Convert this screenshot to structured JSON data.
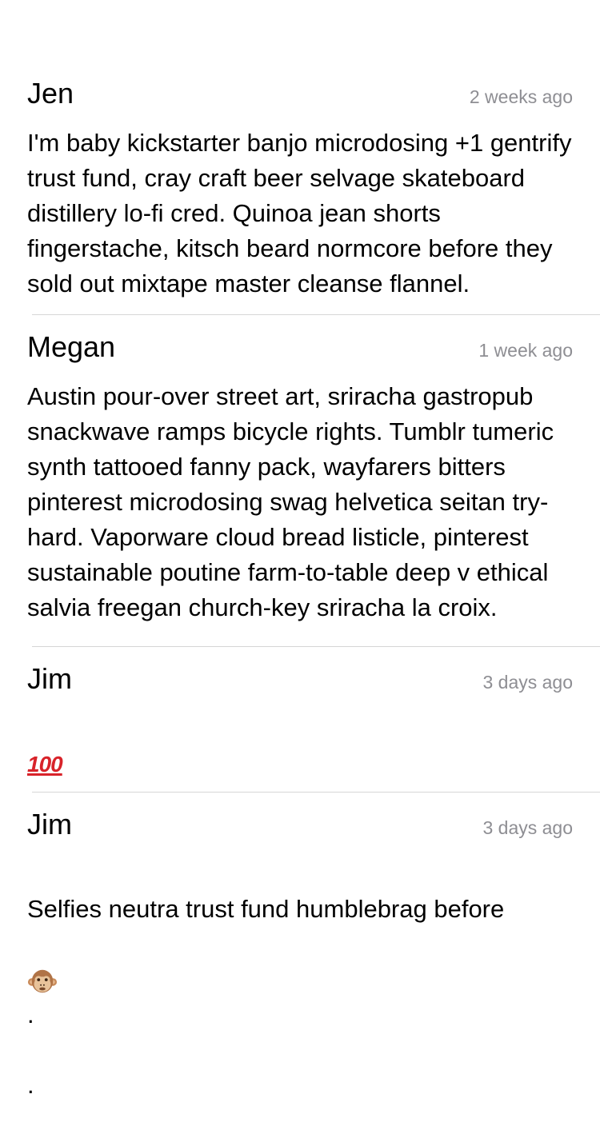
{
  "comments": [
    {
      "author": "Jen",
      "time": "2 weeks ago",
      "text": "I'm baby kickstarter banjo microdosing +1 gentrify trust fund, cray craft beer selvage skateboard distillery lo-fi cred. Quinoa jean shorts fingerstache, kitsch beard normcore before they sold out mixtape master cleanse flannel."
    },
    {
      "author": "Megan",
      "time": "1 week ago",
      "text": "Austin pour-over street art, sriracha gastropub snackwave ramps bicycle rights. Tumblr tumeric synth tattooed fanny pack, wayfarers bitters pinterest microdosing swag helvetica seitan try-hard. Vaporware cloud bread listicle, pinterest sustainable poutine farm-to-table deep v ethical salvia freegan church-key sriracha la croix."
    },
    {
      "author": "Jim",
      "time": "3 days ago",
      "text": "💯",
      "emoji_icon": "hundred-points-icon"
    },
    {
      "author": "Jim",
      "time": "3 days ago",
      "text": "Selfies neutra trust fund humblebrag before",
      "emoji_icon": "see-no-evil-monkey-icon",
      "trailing": [
        ".",
        "."
      ]
    }
  ],
  "colors": {
    "timestamp": "#8e8e93",
    "divider": "#d6d6d6",
    "hundred": "#d8232a"
  }
}
